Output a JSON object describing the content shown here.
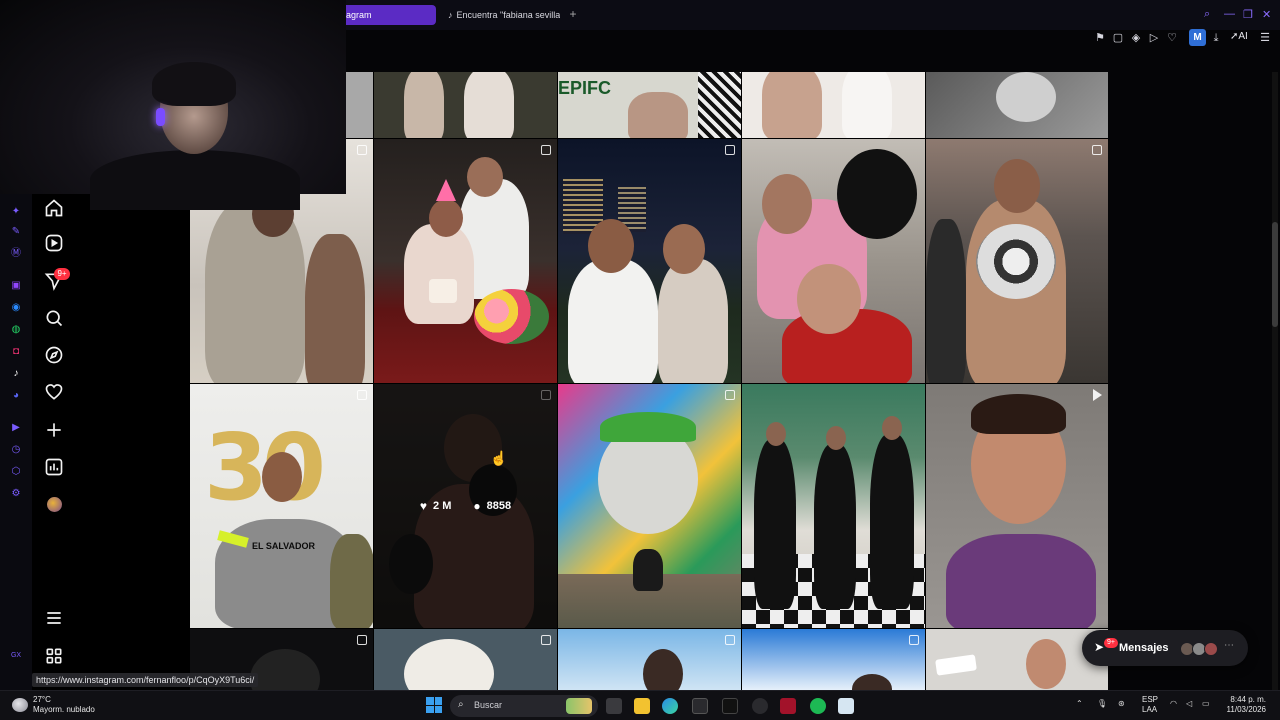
{
  "browser": {
    "tabs": [
      {
        "label": "agram"
      },
      {
        "label": "Encuentra \"fabiana sevilla"
      }
    ],
    "new_tab_label": "+",
    "ai_label": "AI",
    "account_badge": "M"
  },
  "sidebar_nav": {
    "notification_badge": "9+"
  },
  "grid": {
    "hover_post": {
      "likes": "2 M",
      "comments": "8858"
    },
    "birthday_balloons": "30",
    "shirt_text": "EL SALVADOR",
    "jersey_text": "EPIFC"
  },
  "messages": {
    "label": "Mensajes",
    "badge": "9+"
  },
  "status_url": "https://www.instagram.com/fernanfloo/p/CqOyX9Tu6ci/",
  "taskbar": {
    "weather_temp": "27°C",
    "weather_desc": "Mayorm. nublado",
    "search_placeholder": "Buscar",
    "lang_top": "ESP",
    "lang_bottom": "LAA",
    "time": "8:44 p. m.",
    "date": "11/03/2026"
  },
  "colors": {
    "accent": "#5b2bc4",
    "badge_red": "#ff3040",
    "background": "#000000"
  }
}
